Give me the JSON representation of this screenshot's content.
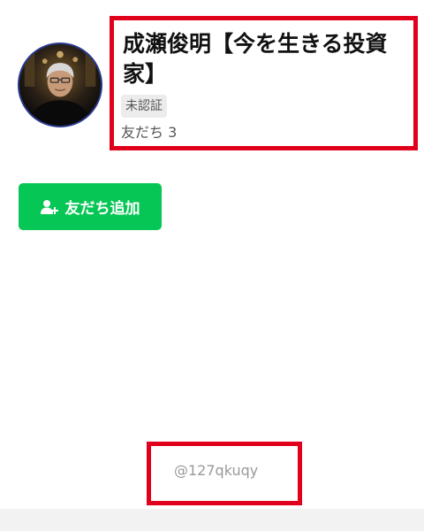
{
  "profile": {
    "avatar_icon": "profile-photo",
    "name": "成瀬俊明【今を生きる投資家】",
    "badge": "未認証",
    "friend_count": "友だち 3"
  },
  "actions": {
    "add_friend_icon": "add-user-icon",
    "add_friend_label": "友だち追加"
  },
  "footer": {
    "account_id": "@127qkuqy"
  },
  "colors": {
    "primary_green": "#06c755",
    "highlight_red": "#e0001b",
    "badge_bg": "#ececec",
    "muted_text": "#999999",
    "footer_bg": "#f2f2f2"
  }
}
